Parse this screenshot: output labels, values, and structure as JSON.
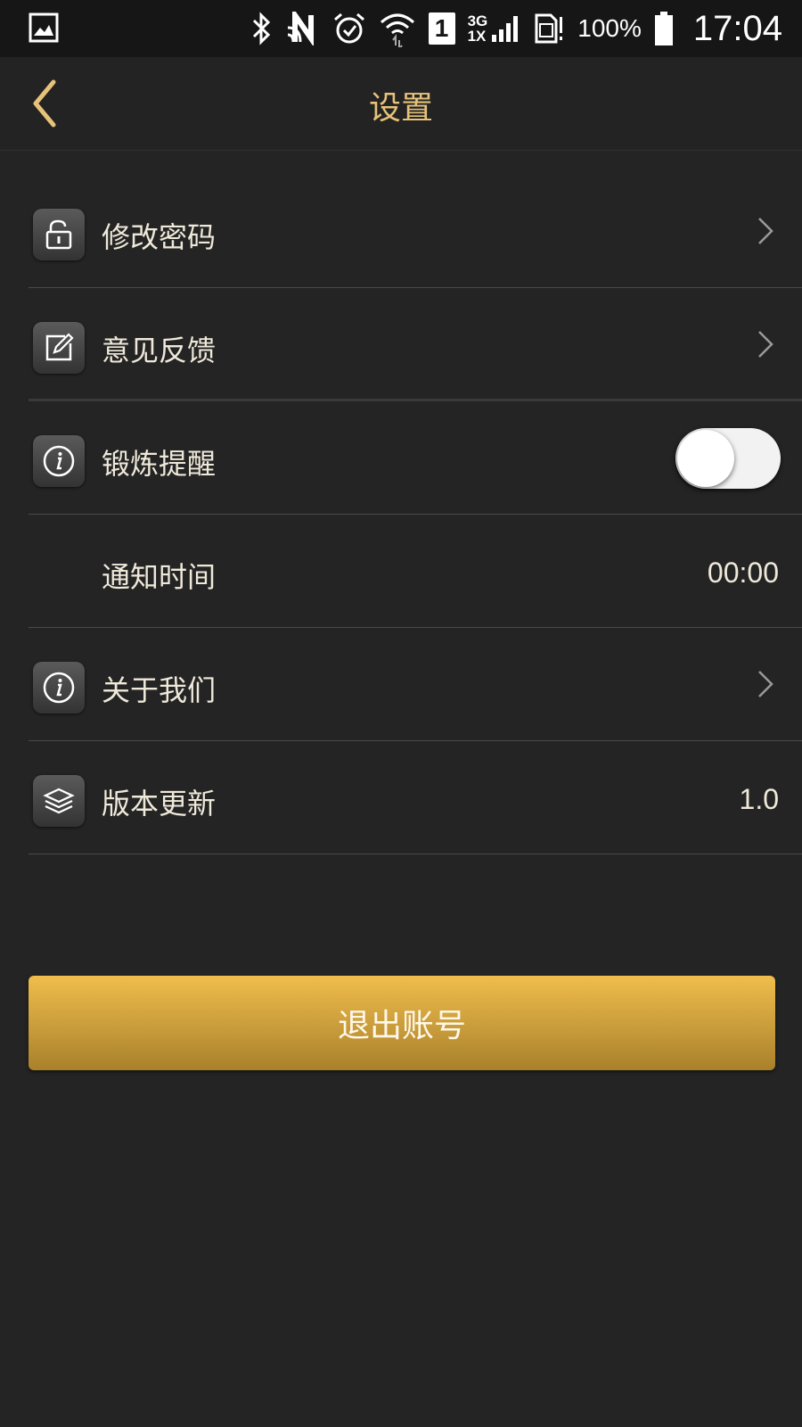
{
  "status_bar": {
    "network_top": "3G",
    "network_bottom": "1X",
    "sim_number": "1",
    "battery_text": "100%",
    "time": "17:04",
    "icons": [
      "gallery-icon",
      "bluetooth-icon",
      "nfc-icon",
      "alarm-icon",
      "wifi-icon",
      "sim-icon",
      "signal-icon",
      "sim-card-icon",
      "battery-icon"
    ]
  },
  "header": {
    "title": "设置",
    "back_icon": "chevron-left-icon"
  },
  "settings": {
    "items": [
      {
        "label": "修改密码",
        "icon": "lock-open-icon"
      },
      {
        "label": "意见反馈",
        "icon": "edit-icon"
      },
      {
        "label": "锻炼提醒",
        "icon": "info-icon",
        "toggle_on": false
      },
      {
        "label": "通知时间",
        "value": "00:00"
      },
      {
        "label": "关于我们",
        "icon": "info-icon"
      },
      {
        "label": "版本更新",
        "icon": "layers-icon",
        "value": "1.0"
      }
    ]
  },
  "logout": {
    "label": "退出账号"
  },
  "colors": {
    "background": "#242424",
    "accent_gold": "#e6c27a",
    "button_top": "#f0bd4c",
    "button_bottom": "#a9812c"
  }
}
